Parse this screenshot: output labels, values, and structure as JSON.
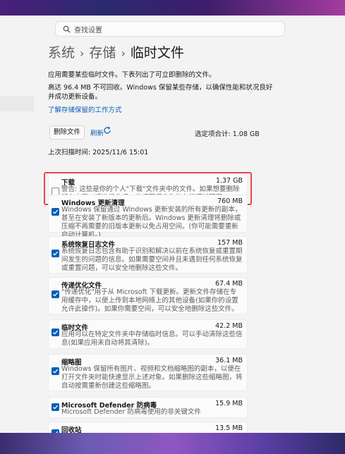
{
  "search": {
    "placeholder": "查找设置"
  },
  "breadcrumb": {
    "items": [
      "系统",
      "存储",
      "临时文件"
    ]
  },
  "intro": "应用需要某些临时文件。下表列出了可立即删除的文件。",
  "warning_text": "高达 96.4 MB 不可回收。Windows 保留某些存储，以确保性能和状况良好并成功更新设备。",
  "link": "了解存储保留的工作方式",
  "toolbar": {
    "delete_label": "删除文件",
    "refresh_label": "刷新",
    "total_label": "选定项合计: 1.08 GB"
  },
  "scan_time": "上次扫描时间: 2025/11/6 15:01",
  "items": [
    {
      "title": "下载",
      "size": "1.37 GB",
      "checked": false,
      "desc": "警告: 这些是你的个人\"下载\"文件夹中的文件。如果想要删除所有内容，请选择此项。此项不遵守你的存储感知配置。"
    },
    {
      "title": "Windows 更新清理",
      "size": "760 MB",
      "checked": true,
      "desc": "Windows 保留通过 Windows 更新安装的所有更新的副本，甚至在安装了新版本的更新后。Windows 更新清理将删除或压缩不再需要的旧版本更新以免占用空间。(你可能需要重新启动计算机。)"
    },
    {
      "title": "系统恢复日志文件",
      "size": "157 MB",
      "checked": true,
      "desc": "系统恢复日志包含有助于识别和解决以前在系统恢复或重置期间发生的问题的信息。如果需要空间并且未遇到任何系统恢复或重置问题，可以安全地删除这些文件。"
    },
    {
      "title": "传递优化文件",
      "size": "67.4 MB",
      "checked": true,
      "desc": "\"传递优化\"用于从 Microsoft 下载更新。更新文件存储在专用缓存中，以便上传到本地网络上的其他设备(如果你的设置允许此操作)。如果你需要空间，可以安全地删除这些文件。"
    },
    {
      "title": "临时文件",
      "size": "42.2 MB",
      "checked": true,
      "desc": "应用可以在特定文件夹中存储临时信息。可以手动清除这些信息(如果应用未自动将其清除)。"
    },
    {
      "title": "缩略图",
      "size": "36.1 MB",
      "checked": true,
      "desc": "Windows 保留所有图片、视频和文档缩略图的副本，以便在打开文件夹时能快速显示上述对象。如果删除这些缩略图，将自动按需重新创建这些缩略图。"
    },
    {
      "title": "Microsoft Defender 防病毒",
      "size": "15.9 MB",
      "checked": true,
      "desc": "Microsoft Defender 防病毒使用的非关键文件"
    },
    {
      "title": "回收站",
      "size": "13.5 MB",
      "checked": true,
      "desc": ""
    }
  ]
}
